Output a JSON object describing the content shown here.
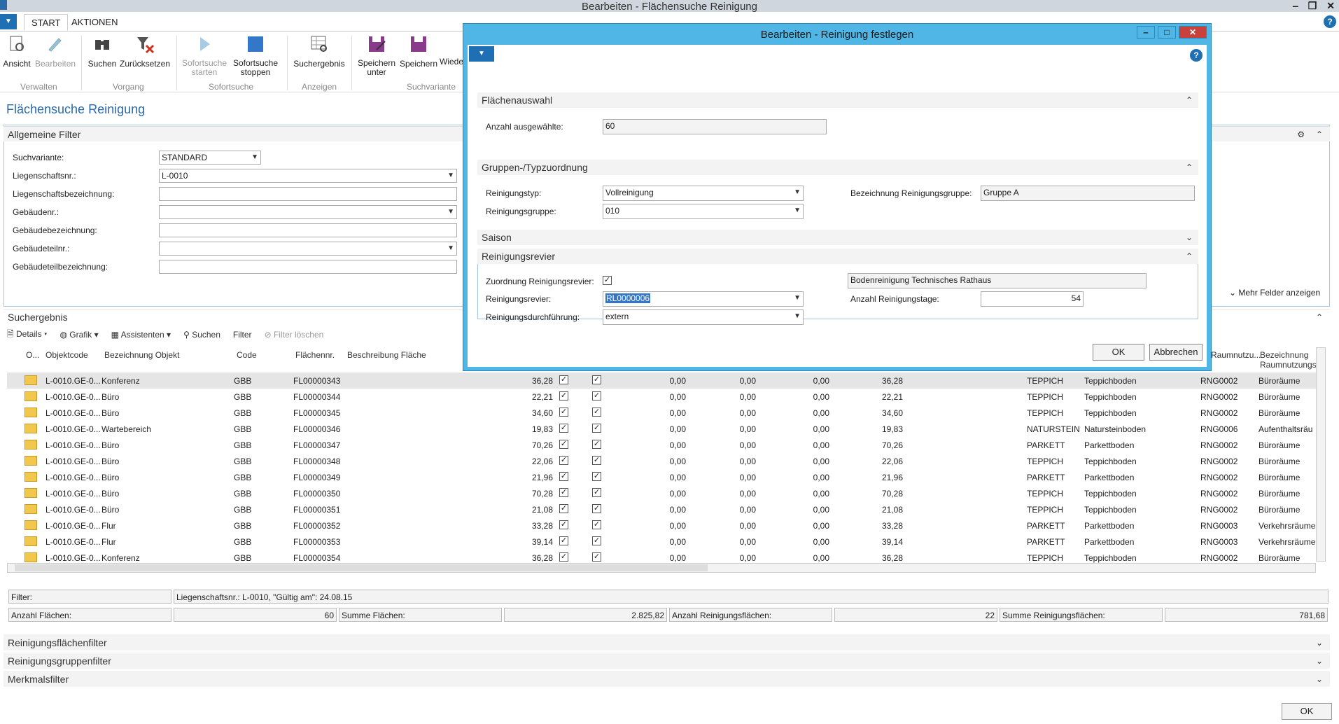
{
  "window": {
    "title": "Bearbeiten - Flächensuche Reinigung",
    "buttons": [
      "‒",
      "❐",
      "✕"
    ]
  },
  "tabs": [
    {
      "label": "START"
    },
    {
      "label": "AKTIONEN"
    }
  ],
  "ribbon": {
    "buttons": [
      {
        "label": "Ansicht",
        "icon": "view-icon"
      },
      {
        "label": "Bearbeiten",
        "icon": "edit-icon"
      },
      {
        "label": "Suchen",
        "icon": "binoculars-icon"
      },
      {
        "label": "Zurücksetzen",
        "icon": "clear-filter-icon"
      },
      {
        "label": "Sofortsuche starten",
        "icon": "play-icon"
      },
      {
        "label": "Sofortsuche stoppen",
        "icon": "stop-icon"
      },
      {
        "label": "Suchergebnis",
        "icon": "search-result-icon"
      },
      {
        "label": "Speichern unter",
        "icon": "save-as-icon"
      },
      {
        "label": "Speichern",
        "icon": "save-icon"
      },
      {
        "label": "Wiede",
        "icon": "restore-icon"
      }
    ],
    "groups": [
      "Verwalten",
      "Vorgang",
      "Sofortsuche",
      "Anzeigen",
      "Suchvariante"
    ]
  },
  "page_title": "Flächensuche Reinigung",
  "general": {
    "title": "Allgemeine Filter",
    "fields": [
      {
        "label": "Suchvariante:",
        "value": "STANDARD"
      },
      {
        "label": "Liegenschaftsnr.:",
        "value": "L-0010"
      },
      {
        "label": "Liegenschaftsbezeichnung:",
        "value": ""
      },
      {
        "label": "Gebäudenr.:",
        "value": ""
      },
      {
        "label": "Gebäudebezeichnung:",
        "value": ""
      },
      {
        "label": "Gebäudeteilnr.:",
        "value": ""
      },
      {
        "label": "Gebäudeteilbezeichnung:",
        "value": ""
      }
    ],
    "more_fields": "Mehr Felder anzeigen"
  },
  "results": {
    "title": "Suchergebnis",
    "toolbar": [
      "Details",
      "Grafik",
      "Assistenten",
      "Suchen",
      "Filter",
      "Filter löschen"
    ],
    "headers": [
      "O...",
      "Objektcode",
      "Bezeichnung Objekt",
      "Code",
      "Flächennr.",
      "Beschreibung Fläche",
      "Raumnutzu...",
      "Bezeichnung Raumnutzungs"
    ],
    "rows": [
      [
        "L-0010.GE-0...",
        "Konferenz",
        "GBB",
        "FL00000343",
        "36,28",
        "0,00",
        "0,00",
        "0,00",
        "36,28",
        "TEPPICH",
        "Teppichboden",
        "RNG0002",
        "Büroräume"
      ],
      [
        "L-0010.GE-0...",
        "Büro",
        "GBB",
        "FL00000344",
        "22,21",
        "0,00",
        "0,00",
        "0,00",
        "22,21",
        "TEPPICH",
        "Teppichboden",
        "RNG0002",
        "Büroräume"
      ],
      [
        "L-0010.GE-0...",
        "Büro",
        "GBB",
        "FL00000345",
        "34,60",
        "0,00",
        "0,00",
        "0,00",
        "34,60",
        "TEPPICH",
        "Teppichboden",
        "RNG0002",
        "Büroräume"
      ],
      [
        "L-0010.GE-0...",
        "Wartebereich",
        "GBB",
        "FL00000346",
        "19,83",
        "0,00",
        "0,00",
        "0,00",
        "19,83",
        "NATURSTEIN",
        "Natursteinboden",
        "RNG0006",
        "Aufenthaltsräu"
      ],
      [
        "L-0010.GE-0...",
        "Büro",
        "GBB",
        "FL00000347",
        "70,26",
        "0,00",
        "0,00",
        "0,00",
        "70,26",
        "PARKETT",
        "Parkettboden",
        "RNG0002",
        "Büroräume"
      ],
      [
        "L-0010.GE-0...",
        "Büro",
        "GBB",
        "FL00000348",
        "22,06",
        "0,00",
        "0,00",
        "0,00",
        "22,06",
        "TEPPICH",
        "Teppichboden",
        "RNG0002",
        "Büroräume"
      ],
      [
        "L-0010.GE-0...",
        "Büro",
        "GBB",
        "FL00000349",
        "21,96",
        "0,00",
        "0,00",
        "0,00",
        "21,96",
        "PARKETT",
        "Parkettboden",
        "RNG0002",
        "Büroräume"
      ],
      [
        "L-0010.GE-0...",
        "Büro",
        "GBB",
        "FL00000350",
        "70,28",
        "0,00",
        "0,00",
        "0,00",
        "70,28",
        "TEPPICH",
        "Teppichboden",
        "RNG0002",
        "Büroräume"
      ],
      [
        "L-0010.GE-0...",
        "Büro",
        "GBB",
        "FL00000351",
        "21,08",
        "0,00",
        "0,00",
        "0,00",
        "21,08",
        "TEPPICH",
        "Teppichboden",
        "RNG0002",
        "Büroräume"
      ],
      [
        "L-0010.GE-0...",
        "Flur",
        "GBB",
        "FL00000352",
        "33,28",
        "0,00",
        "0,00",
        "0,00",
        "33,28",
        "PARKETT",
        "Parkettboden",
        "RNG0003",
        "Verkehrsräume"
      ],
      [
        "L-0010.GE-0...",
        "Flur",
        "GBB",
        "FL00000353",
        "39,14",
        "0,00",
        "0,00",
        "0,00",
        "39,14",
        "PARKETT",
        "Parkettboden",
        "RNG0003",
        "Verkehrsräume"
      ],
      [
        "L-0010.GE-0...",
        "Konferenz",
        "GBB",
        "FL00000354",
        "36,28",
        "0,00",
        "0,00",
        "0,00",
        "36,28",
        "TEPPICH",
        "Teppichboden",
        "RNG0002",
        "Büroräume"
      ]
    ]
  },
  "summary": {
    "filter_label": "Filter:",
    "filter_value": "Liegenschaftsnr.: L-0010, \"Gültig am\": 24.08.15",
    "count_label": "Anzahl Flächen:",
    "count_value": "60",
    "sum_label": "Summe Flächen:",
    "sum_value": "2.825,82",
    "clean_count_label": "Anzahl Reinigungsflächen:",
    "clean_count_value": "22",
    "clean_sum_label": "Summe Reinigungsflächen:",
    "clean_sum_value": "781,68"
  },
  "lower_tabs": [
    "Reinigungsflächenfilter",
    "Reinigungsgruppenfilter",
    "Merkmalsfilter"
  ],
  "ok_label": "OK",
  "dialog": {
    "title": "Bearbeiten - Reinigung festlegen",
    "sec1": "Flächenauswahl",
    "anzahl_label": "Anzahl ausgewählte:",
    "anzahl_value": "60",
    "sec2": "Gruppen-/Typzuordnung",
    "typ_label": "Reinigungstyp:",
    "typ_value": "Vollreinigung",
    "gruppe_label": "Reinigungsgruppe:",
    "gruppe_value": "010",
    "bez_gruppe_label": "Bezeichnung Reinigungsgruppe:",
    "bez_gruppe_value": "Gruppe A",
    "sec3": "Saison",
    "sec4": "Reinigungsrevier",
    "zuord_label": "Zuordnung Reinigungsrevier:",
    "revier_label": "Reinigungsrevier:",
    "revier_value": "RL0000006",
    "durch_label": "Reinigungsdurchführung:",
    "durch_value": "extern",
    "revier_bez_value": "Bodenreinigung Technisches Rathaus",
    "tage_label": "Anzahl Reinigungstage:",
    "tage_value": "54",
    "ok": "OK",
    "cancel": "Abbrechen"
  }
}
